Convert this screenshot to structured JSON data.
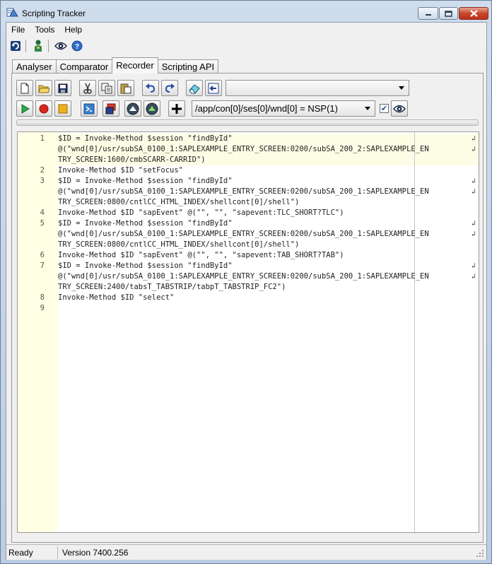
{
  "window": {
    "title": "Scripting Tracker",
    "accent_color": "#c7d6e8"
  },
  "menu": [
    "File",
    "Tools",
    "Help"
  ],
  "toolbar_icons": [
    "refresh-icon",
    "user-icon",
    "eye-icon",
    "help-icon"
  ],
  "tabs": [
    {
      "label": "Analyser",
      "active": false
    },
    {
      "label": "Comparator",
      "active": false
    },
    {
      "label": "Recorder",
      "active": true
    },
    {
      "label": "Scripting API",
      "active": false
    }
  ],
  "recorder": {
    "script_combo_value": "",
    "path_combo_value": "/app/con[0]/ses[0]/wnd[0] = NSP(1)",
    "checkbox_checked": true
  },
  "editor": {
    "lines": [
      {
        "num": "1",
        "rows": [
          "$ID = Invoke-Method $session \"findById\"",
          "@(\"wnd[0]/usr/subSA_0100_1:SAPLEXAMPLE_ENTRY_SCREEN:0200/subSA_200_2:SAPLEXAMPLE_EN",
          "TRY_SCREEN:1600/cmbSCARR-CARRID\")"
        ]
      },
      {
        "num": "2",
        "rows": [
          "Invoke-Method $ID \"setFocus\""
        ]
      },
      {
        "num": "3",
        "rows": [
          "$ID = Invoke-Method $session \"findById\"",
          "@(\"wnd[0]/usr/subSA_0100_1:SAPLEXAMPLE_ENTRY_SCREEN:0200/subSA_200_1:SAPLEXAMPLE_EN",
          "TRY_SCREEN:0800/cntlCC_HTML_INDEX/shellcont[0]/shell\")"
        ]
      },
      {
        "num": "4",
        "rows": [
          "Invoke-Method $ID \"sapEvent\" @(\"\", \"\", \"sapevent:TLC_SHORT?TLC\")"
        ]
      },
      {
        "num": "5",
        "rows": [
          "$ID = Invoke-Method $session \"findById\"",
          "@(\"wnd[0]/usr/subSA_0100_1:SAPLEXAMPLE_ENTRY_SCREEN:0200/subSA_200_1:SAPLEXAMPLE_EN",
          "TRY_SCREEN:0800/cntlCC_HTML_INDEX/shellcont[0]/shell\")"
        ]
      },
      {
        "num": "6",
        "rows": [
          "Invoke-Method $ID \"sapEvent\" @(\"\", \"\", \"sapevent:TAB_SHORT?TAB\")"
        ]
      },
      {
        "num": "7",
        "rows": [
          "$ID = Invoke-Method $session \"findById\"",
          "@(\"wnd[0]/usr/subSA_0100_1:SAPLEXAMPLE_ENTRY_SCREEN:0200/subSA_200_1:SAPLEXAMPLE_EN",
          "TRY_SCREEN:2400/tabsT_TABSTRIP/tabpT_TABSTRIP_FC2\")"
        ]
      },
      {
        "num": "8",
        "rows": [
          "Invoke-Method $ID \"select\""
        ]
      },
      {
        "num": "9",
        "rows": [
          ""
        ]
      }
    ]
  },
  "status": {
    "state": "Ready",
    "version": "Version 7400.256"
  }
}
